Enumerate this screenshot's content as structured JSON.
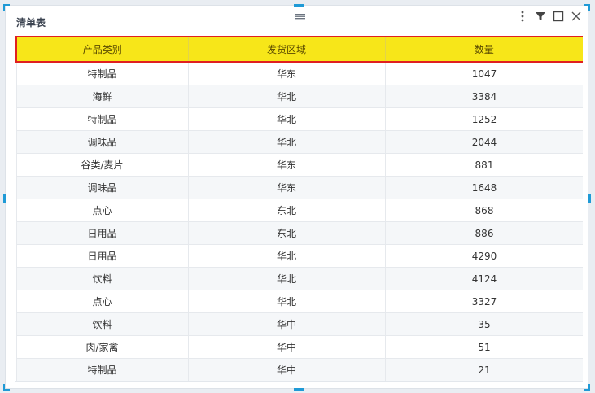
{
  "widget": {
    "title": "清单表"
  },
  "table": {
    "headers": [
      "产品类别",
      "发货区域",
      "数量"
    ],
    "rows": [
      [
        "特制品",
        "华东",
        "1047"
      ],
      [
        "海鲜",
        "华北",
        "3384"
      ],
      [
        "特制品",
        "华北",
        "1252"
      ],
      [
        "调味品",
        "华北",
        "2044"
      ],
      [
        "谷类/麦片",
        "华东",
        "881"
      ],
      [
        "调味品",
        "华东",
        "1648"
      ],
      [
        "点心",
        "东北",
        "868"
      ],
      [
        "日用品",
        "东北",
        "886"
      ],
      [
        "日用品",
        "华北",
        "4290"
      ],
      [
        "饮料",
        "华北",
        "4124"
      ],
      [
        "点心",
        "华北",
        "3327"
      ],
      [
        "饮料",
        "华中",
        "35"
      ],
      [
        "肉/家禽",
        "华中",
        "51"
      ],
      [
        "特制品",
        "华中",
        "21"
      ]
    ]
  },
  "icons": {
    "drag": "drag-handle-icon",
    "more": "more-vertical-icon",
    "filter": "filter-icon",
    "maximize": "maximize-icon",
    "close": "close-icon"
  },
  "colors": {
    "header_bg": "#f7e619",
    "header_border": "#e02020",
    "resize_handle": "#1f9ad6"
  }
}
